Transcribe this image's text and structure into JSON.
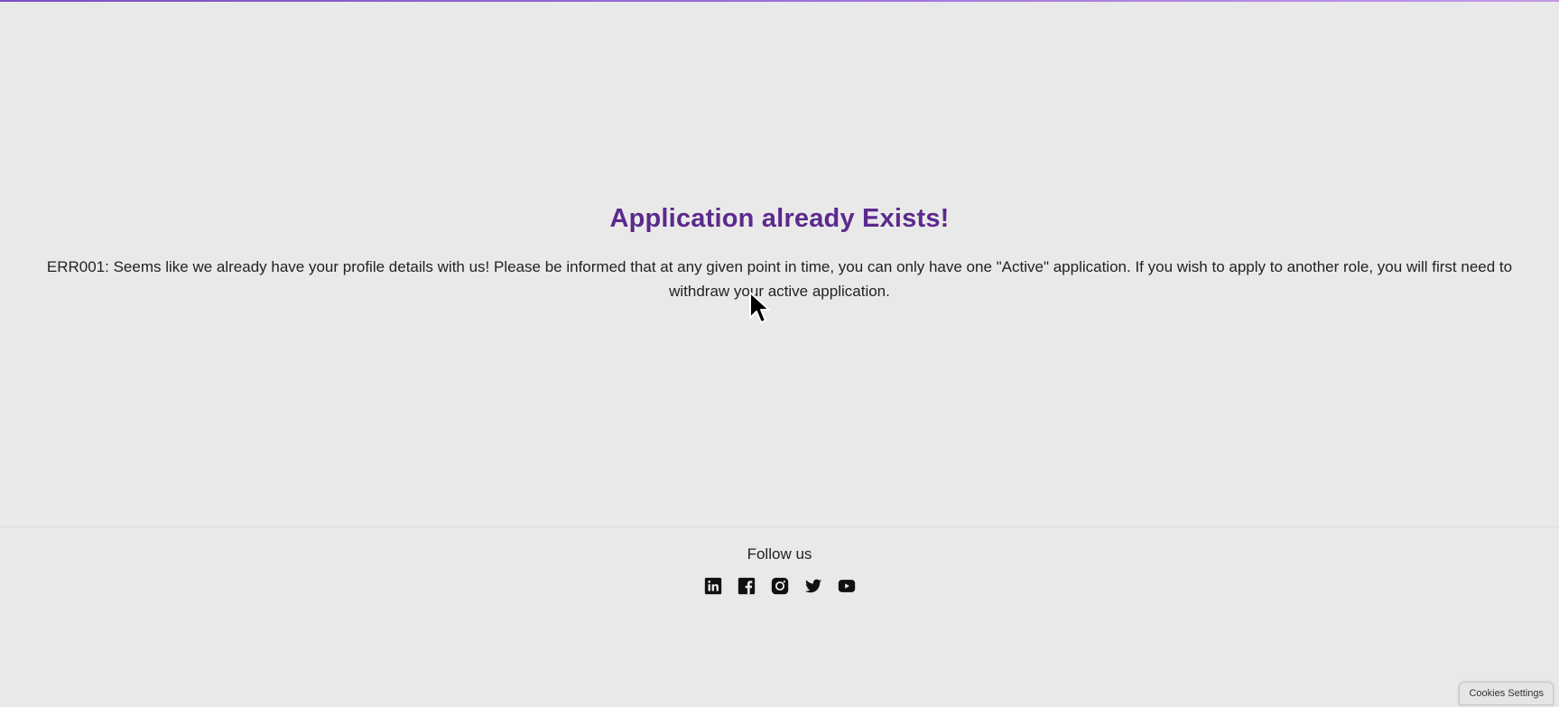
{
  "error": {
    "title": "Application already Exists!",
    "message": "ERR001: Seems like we already have your profile details with us! Please be informed that at any given point in time, you can only have one \"Active\" application. If you wish to apply to another role, you will first need to withdraw your active application."
  },
  "footer": {
    "follow_label": "Follow us",
    "social": [
      {
        "icon": "linkedin-icon"
      },
      {
        "icon": "facebook-icon"
      },
      {
        "icon": "instagram-icon"
      },
      {
        "icon": "twitter-icon"
      },
      {
        "icon": "youtube-icon"
      }
    ]
  },
  "cookies": {
    "label": "Cookies Settings"
  },
  "colors": {
    "background": "#eae9ea",
    "title": "#5b2a8c",
    "text": "#222222"
  }
}
